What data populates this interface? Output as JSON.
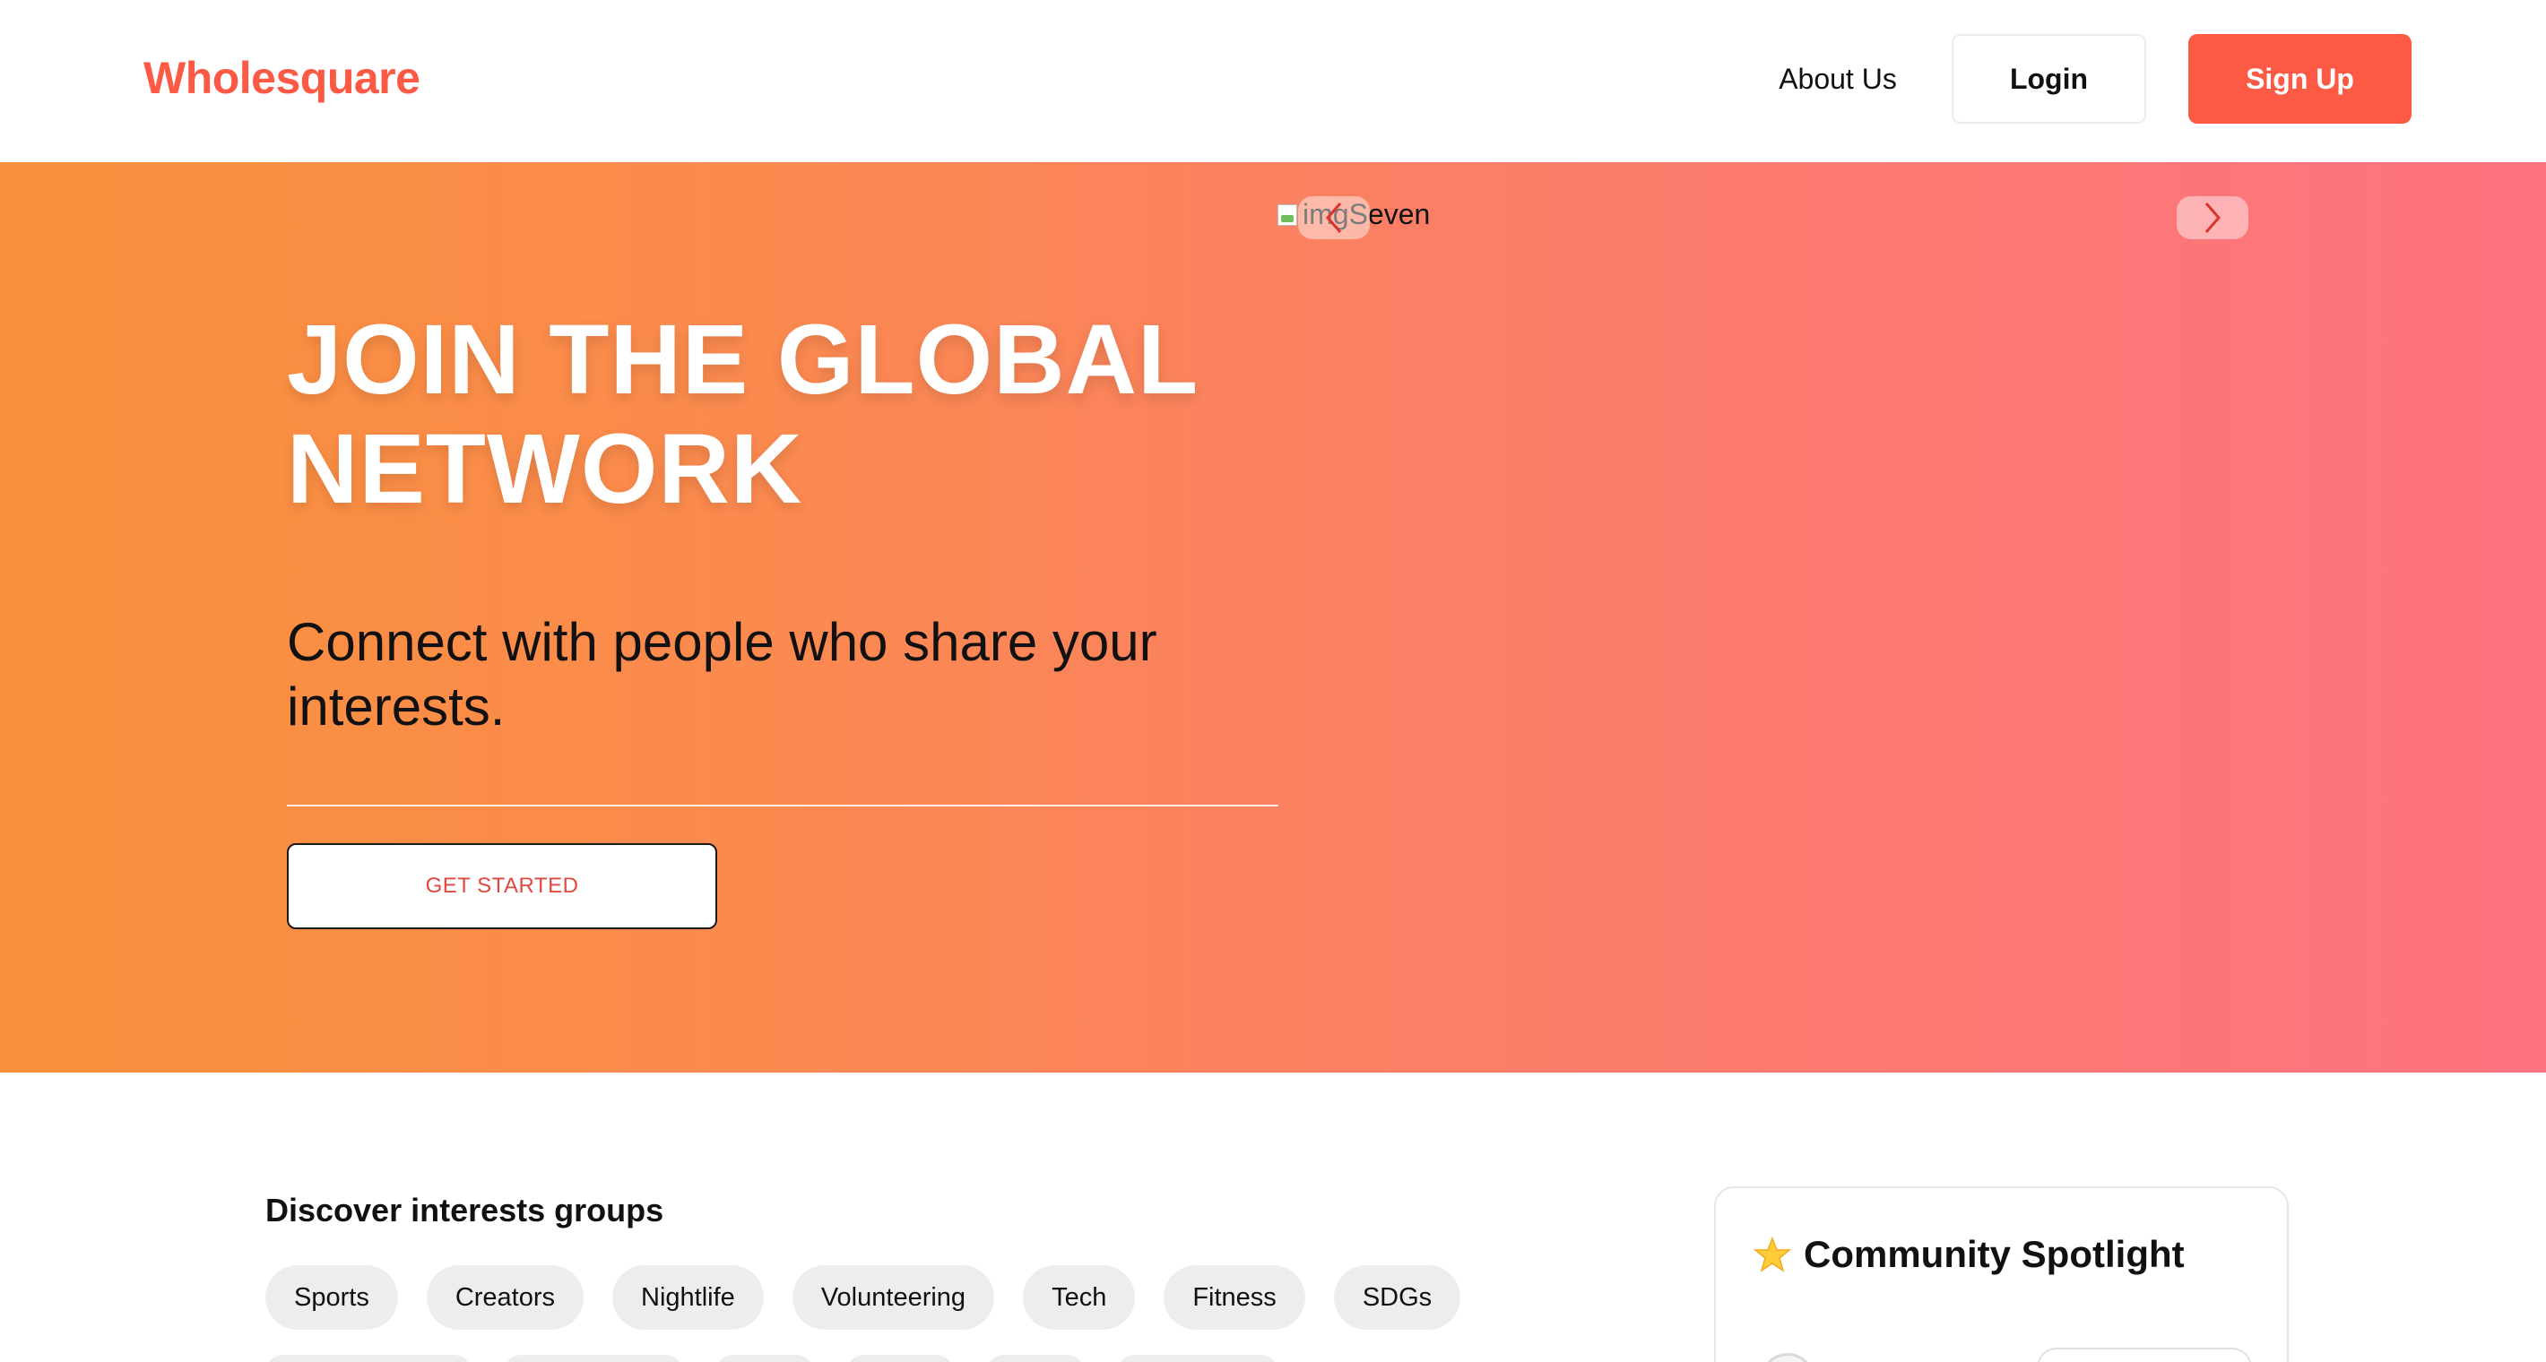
{
  "header": {
    "brand": "Wholesquare",
    "about": "About Us",
    "login": "Login",
    "signup": "Sign Up"
  },
  "hero": {
    "title": "JOIN THE GLOBAL NETWORK",
    "subtitle": "Connect with people who share your interests.",
    "cta": "GET STARTED",
    "carousel_img_alt": "imgSeven",
    "prev_icon": "chevron-left-icon",
    "next_icon": "chevron-right-icon"
  },
  "discover": {
    "title": "Discover interests groups",
    "groups": [
      "Sports",
      "Creators",
      "Nightlife",
      "Volunteering",
      "Tech",
      "Fitness",
      "SDGs"
    ]
  },
  "spotlight": {
    "title": "Community Spotlight",
    "icon": "star-icon"
  },
  "colors": {
    "brand": "#fc5a44",
    "hero_start": "#fa913c",
    "hero_end": "#fd7381",
    "chip_bg": "#ededed"
  }
}
